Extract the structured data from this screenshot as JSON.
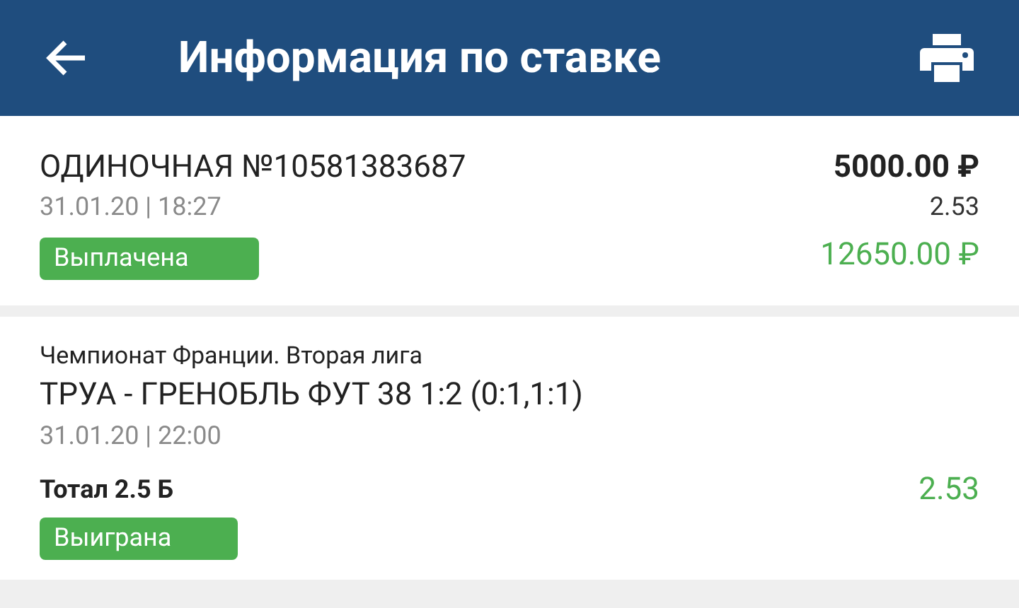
{
  "header": {
    "title": "Информация по ставке"
  },
  "bet": {
    "title": "ОДИНОЧНАЯ №10581383687",
    "datetime": "31.01.20 | 18:27",
    "status": {
      "label": "Выплачена",
      "kind": "success"
    },
    "stake": "5000.00 ₽",
    "odds": "2.53",
    "payout": "12650.00 ₽"
  },
  "events": [
    {
      "league": "Чемпионат Франции. Вторая лига",
      "match": "ТРУА - ГРЕНОБЛЬ ФУТ 38 1:2 (0:1,1:1)",
      "datetime": "31.01.20 | 22:00",
      "market": "Тотал 2.5 Б",
      "odds": "2.53",
      "status": {
        "label": "Выиграна",
        "kind": "success"
      }
    }
  ]
}
